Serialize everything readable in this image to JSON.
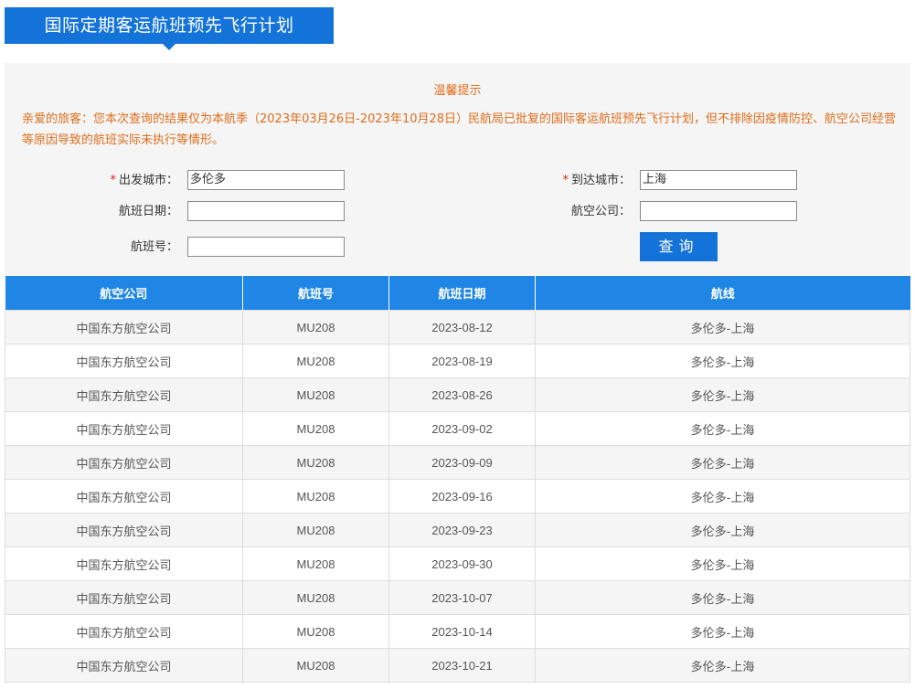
{
  "header": {
    "title": "国际定期客运航班预先飞行计划"
  },
  "notice": {
    "title": "温馨提示",
    "text": "亲爱的旅客：您本次查询的结果仅为本航季（2023年03月26日-2023年10月28日）民航局已批复的国际客运航班预先飞行计划，但不排除因疫情防控、航空公司经营等原因导致的航班实际未执行等情形。"
  },
  "form": {
    "required_mark": "*",
    "departure_label": "出发城市：",
    "departure_value": "多伦多",
    "arrival_label": "到达城市：",
    "arrival_value": "上海",
    "date_label": "航班日期：",
    "date_value": "",
    "airline_label": "航空公司：",
    "airline_value": "",
    "flight_no_label": "航班号：",
    "flight_no_value": "",
    "search_label": "查询"
  },
  "table": {
    "columns": [
      "航空公司",
      "航班号",
      "航班日期",
      "航线"
    ],
    "rows": [
      [
        "中国东方航空公司",
        "MU208",
        "2023-08-12",
        "多伦多-上海"
      ],
      [
        "中国东方航空公司",
        "MU208",
        "2023-08-19",
        "多伦多-上海"
      ],
      [
        "中国东方航空公司",
        "MU208",
        "2023-08-26",
        "多伦多-上海"
      ],
      [
        "中国东方航空公司",
        "MU208",
        "2023-09-02",
        "多伦多-上海"
      ],
      [
        "中国东方航空公司",
        "MU208",
        "2023-09-09",
        "多伦多-上海"
      ],
      [
        "中国东方航空公司",
        "MU208",
        "2023-09-16",
        "多伦多-上海"
      ],
      [
        "中国东方航空公司",
        "MU208",
        "2023-09-23",
        "多伦多-上海"
      ],
      [
        "中国东方航空公司",
        "MU208",
        "2023-09-30",
        "多伦多-上海"
      ],
      [
        "中国东方航空公司",
        "MU208",
        "2023-10-07",
        "多伦多-上海"
      ],
      [
        "中国东方航空公司",
        "MU208",
        "2023-10-14",
        "多伦多-上海"
      ],
      [
        "中国东方航空公司",
        "MU208",
        "2023-10-21",
        "多伦多-上海"
      ]
    ]
  },
  "colors": {
    "accent": "#1473d8",
    "table_header": "#1f86e6",
    "notice": "#e06d1a",
    "required": "#e02020"
  }
}
